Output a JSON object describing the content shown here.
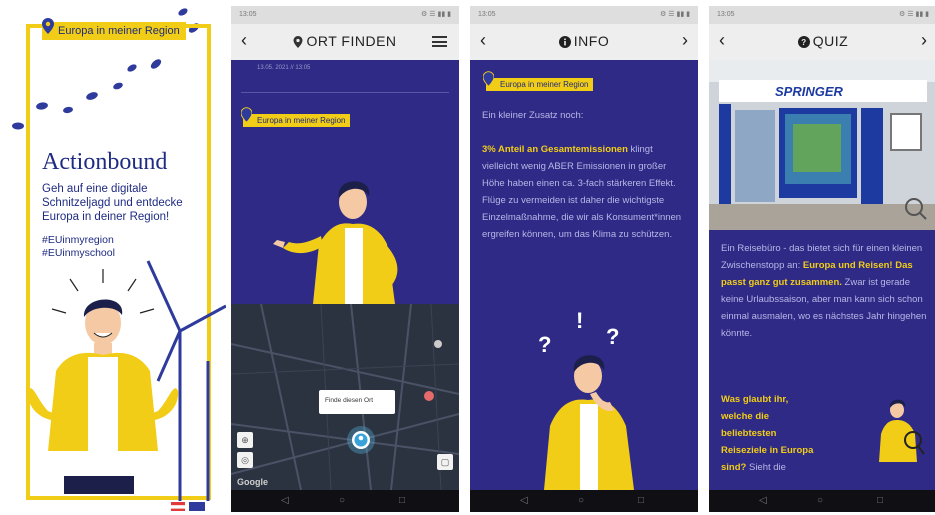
{
  "poster": {
    "chip": "Europa in meiner Region",
    "title": "Actionbound",
    "subtitle": "Geh auf eine digitale Schnitzeljagd und entdecke Europa in deiner Region!",
    "tags": [
      "#EUinmyregion",
      "#EUinmyschool"
    ]
  },
  "phone_find": {
    "status_time": "13:05",
    "status_right": "⚙ ☰ ▮▮ ▮",
    "title": "ORT FINDEN",
    "date_text": "13.05. 2021 // 13:05",
    "chip": "Europa in meiner Region",
    "map_popup": "Finde diesen Ort",
    "map_google": "Google"
  },
  "phone_info": {
    "status_time": "13:05",
    "status_right": "⚙ ☰ ▮▮ ▮",
    "title": "INFO",
    "chip": "Europa in meiner Region",
    "intro": "Ein kleiner Zusatz noch:",
    "highlight": "3% Anteil an Gesamtemissionen",
    "body": "klingt vielleicht wenig ABER Emissionen in großer Höhe haben einen ca. 3-fach stärkeren Effekt. Flüge zu vermeiden ist daher die wichtigste Einzelmaßnahme, die wir als Konsument*innen ergreifen können, um das Klima zu schützen."
  },
  "phone_quiz": {
    "status_time": "13:05",
    "status_right": "⚙ ☰ ▮▮ ▮",
    "title": "QUIZ",
    "shop_sign": "SPRINGER",
    "text_a": "Ein Reisebüro - das bietet sich für einen kleinen Zwischenstopp an:",
    "text_hl1": "Europa und Reisen! Das passt ganz gut zusammen.",
    "text_b": "Zwar ist gerade keine Urlaubssaison, aber man kann sich schon einmal ausmalen, wo es nächstes Jahr hingehen könnte.",
    "question_hl": "Was glaubt ihr, welche die beliebtesten Reiseziele in Europa sind?",
    "question_tail": "Sieht die"
  },
  "colors": {
    "navy": "#2e2a86",
    "yellow": "#f2cd18",
    "poster_blue": "#1f2b82"
  }
}
